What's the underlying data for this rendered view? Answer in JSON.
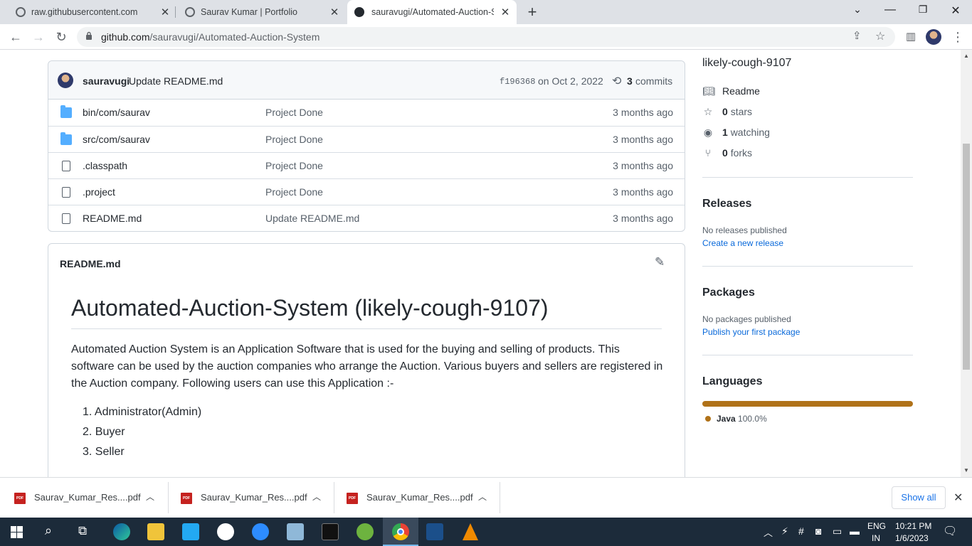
{
  "browser": {
    "tabs": [
      {
        "title": "raw.githubusercontent.com"
      },
      {
        "title": "Saurav Kumar | Portfolio"
      },
      {
        "title": "sauravugi/Automated-Auction-Sy"
      }
    ],
    "url_host": "github.com",
    "url_path": "/sauravugi/Automated-Auction-System"
  },
  "repo": {
    "commit": {
      "author": "sauravugi",
      "message": "Update README.md",
      "hash": "f196368",
      "date": "on Oct 2, 2022",
      "commits_count": "3",
      "commits_label": "commits"
    },
    "files": [
      {
        "name": "bin/com/saurav",
        "type": "folder",
        "message": "Project Done",
        "age": "3 months ago"
      },
      {
        "name": "src/com/saurav",
        "type": "folder",
        "message": "Project Done",
        "age": "3 months ago"
      },
      {
        "name": ".classpath",
        "type": "file",
        "message": "Project Done",
        "age": "3 months ago"
      },
      {
        "name": ".project",
        "type": "file",
        "message": "Project Done",
        "age": "3 months ago"
      },
      {
        "name": "README.md",
        "type": "file",
        "message": "Update README.md",
        "age": "3 months ago"
      }
    ]
  },
  "readme": {
    "filename": "README.md",
    "heading": "Automated-Auction-System (likely-cough-9107)",
    "paragraph": "Automated Auction System is an Application Software that is used for the buying and selling of products. This software can be used by the auction companies who arrange the Auction. Various buyers and sellers are registered in the Auction company. Following users can use this Application :-",
    "list": [
      "1. Administrator(Admin)",
      "2. Buyer",
      "3. Seller"
    ]
  },
  "sidebar": {
    "about_text": "likely-cough-9107",
    "readme_label": "Readme",
    "stars_count": "0",
    "stars_label": "stars",
    "watching_count": "1",
    "watching_label": "watching",
    "forks_count": "0",
    "forks_label": "forks",
    "releases_title": "Releases",
    "releases_none": "No releases published",
    "releases_link": "Create a new release",
    "packages_title": "Packages",
    "packages_none": "No packages published",
    "packages_link": "Publish your first package",
    "languages_title": "Languages",
    "language_name": "Java",
    "language_pct": "100.0%",
    "language_fraction": 1.0,
    "language_color": "#b07219"
  },
  "downloads": {
    "items": [
      {
        "name": "Saurav_Kumar_Res....pdf"
      },
      {
        "name": "Saurav_Kumar_Res....pdf"
      },
      {
        "name": "Saurav_Kumar_Res....pdf"
      }
    ],
    "show_all": "Show all"
  },
  "taskbar": {
    "lang_top": "ENG",
    "lang_bottom": "IN",
    "time": "10:21 PM",
    "date": "1/6/2023"
  }
}
